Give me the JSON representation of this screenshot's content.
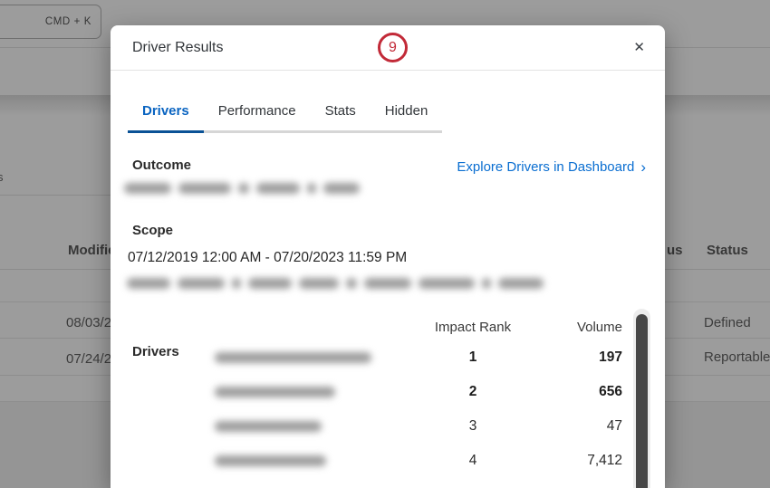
{
  "background": {
    "shortcut_hint": "CMD + K",
    "edge_fragment": "s",
    "table": {
      "left_header": "Modified",
      "right_header_fragment": "us",
      "right_header": "Status",
      "left_rows": [
        "08/03/2",
        "07/24/2"
      ],
      "right_rows": [
        "Defined",
        "Reportable"
      ]
    }
  },
  "modal": {
    "title": "Driver Results",
    "annotation": "9",
    "close_icon": "✕",
    "tabs": [
      "Drivers",
      "Performance",
      "Stats",
      "Hidden"
    ],
    "active_tab": "Drivers",
    "sections": {
      "outcome_heading": "Outcome",
      "explore_link": "Explore Drivers in Dashboard",
      "link_chevron": "›",
      "scope_heading": "Scope",
      "scope_dates": "07/12/2019 12:00 AM - 07/20/2023 11:59 PM",
      "drivers_heading": "Drivers"
    },
    "drivers_table": {
      "columns": [
        "Impact Rank",
        "Volume"
      ],
      "rows": [
        {
          "rank": "1",
          "volume": "197"
        },
        {
          "rank": "2",
          "volume": "656"
        },
        {
          "rank": "3",
          "volume": "47"
        },
        {
          "rank": "4",
          "volume": "7,412"
        }
      ]
    }
  },
  "colors": {
    "link_blue": "#0a6ed1",
    "tab_active_blue": "#0a64c1",
    "tab_underline_blue": "#0a5296",
    "annotation_red": "#c22a38",
    "overlay_gray": "#9c9c9c"
  }
}
